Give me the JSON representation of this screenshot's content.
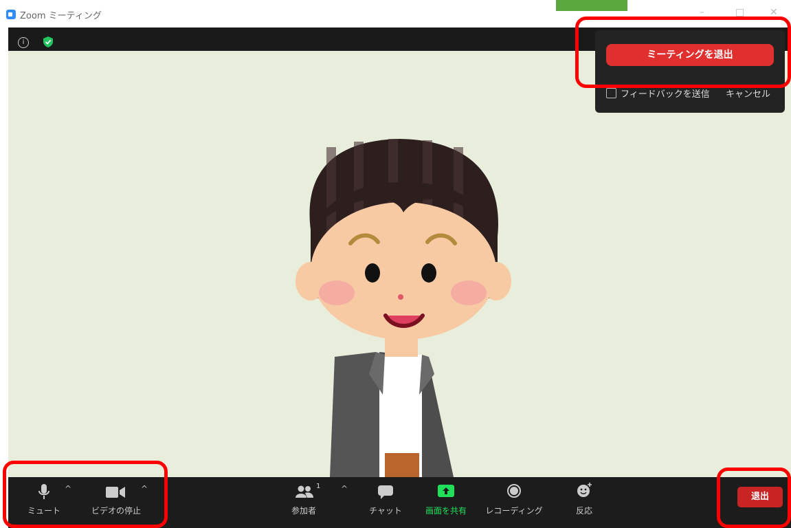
{
  "window": {
    "title": "Zoom ミーティング"
  },
  "leave_popup": {
    "leave_meeting_label": "ミーティングを退出",
    "feedback_label": "フィードバックを送信",
    "cancel_label": "キャンセル"
  },
  "toolbar": {
    "mute_label": "ミュート",
    "video_label": "ビデオの停止",
    "participants_label": "参加者",
    "participants_count": "1",
    "chat_label": "チャット",
    "share_label": "画面を共有",
    "record_label": "レコーディング",
    "reactions_label": "反応",
    "leave_label": "退出",
    "caret_symbol": "^"
  },
  "colors": {
    "share_accent": "#1fe05a",
    "leave_red": "#e02f2f",
    "annotation_red": "#ff0000",
    "video_background": "#e9eddc"
  }
}
